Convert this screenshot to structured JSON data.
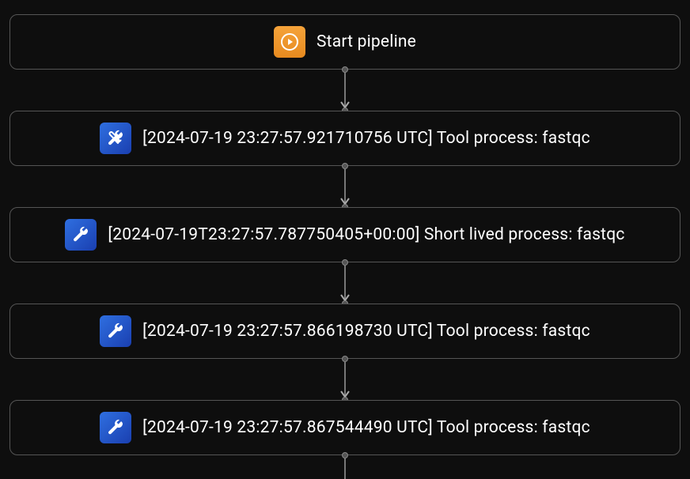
{
  "nodes": [
    {
      "kind": "start",
      "label": "Start pipeline"
    },
    {
      "kind": "tool",
      "label": "[2024-07-19 23:27:57.921710756 UTC] Tool process: fastqc"
    },
    {
      "kind": "tool",
      "label": "[2024-07-19T23:27:57.787750405+00:00] Short lived process: fastqc"
    },
    {
      "kind": "tool",
      "label": "[2024-07-19 23:27:57.866198730 UTC] Tool process: fastqc"
    },
    {
      "kind": "tool",
      "label": "[2024-07-19 23:27:57.867544490 UTC] Tool process: fastqc"
    }
  ],
  "colors": {
    "start_icon_bg": "#f5a33a",
    "tool_icon_bg_from": "#2f6fe0",
    "tool_icon_bg_to": "#1a3fb0",
    "node_border": "#555555",
    "bg": "#0e0e0e"
  }
}
